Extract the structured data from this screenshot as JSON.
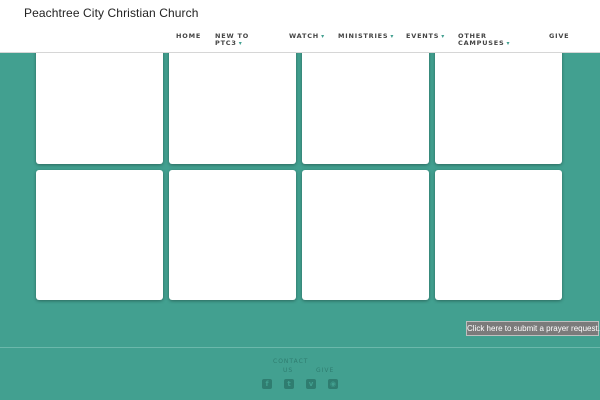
{
  "header": {
    "site_title": "Peachtree City Christian Church",
    "nav": {
      "home": "HOME",
      "new_to_line1": "NEW TO",
      "new_to_line2": "PTC3",
      "watch": "WATCH",
      "ministries": "MINISTRIES",
      "events": "EVENTS",
      "other_line1": "OTHER",
      "other_line2": "CAMPUSES",
      "give": "GIVE"
    },
    "dropdown_glyph": "▾"
  },
  "prayer_button": {
    "label": "Click here to submit a prayer request."
  },
  "footer": {
    "contact_line1": "CONTACT",
    "contact_line2": "US",
    "give": "GIVE",
    "social_icons": [
      "facebook-icon",
      "twitter-icon",
      "vimeo-icon",
      "instagram-icon"
    ]
  },
  "colors": {
    "background": "#42a090",
    "header": "#ffffff",
    "prayer_button": "#7b7b7b",
    "footer_text": "#2f7d70"
  }
}
